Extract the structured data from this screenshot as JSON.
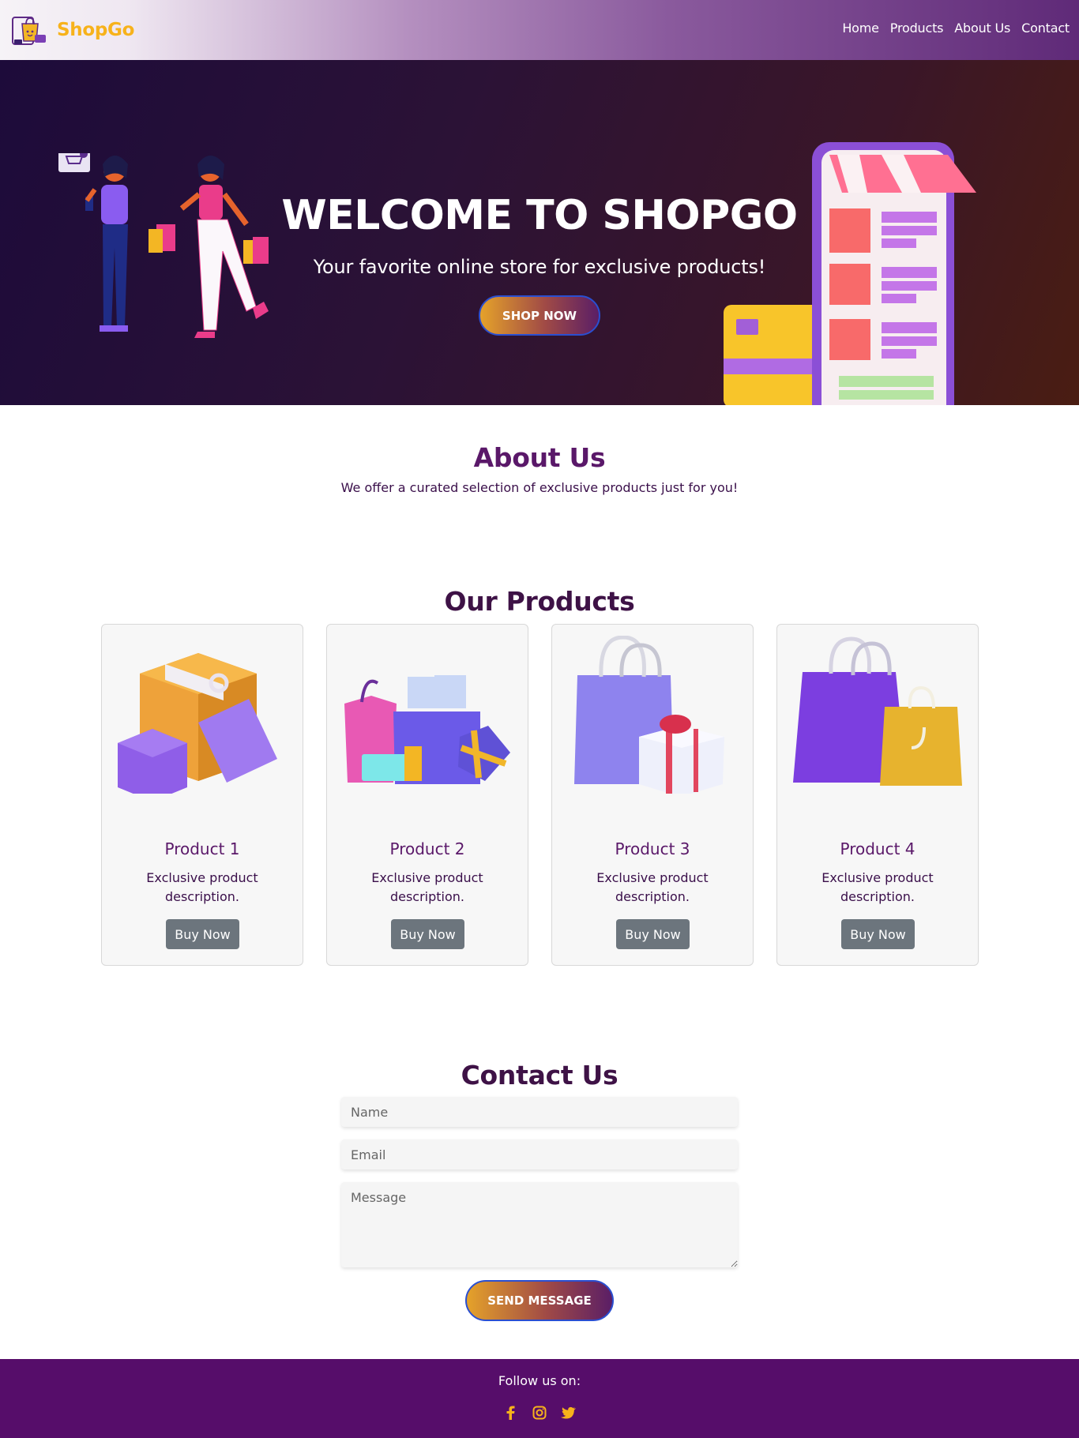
{
  "brand": {
    "name": "ShopGo"
  },
  "nav": {
    "items": [
      {
        "label": "Home"
      },
      {
        "label": "Products"
      },
      {
        "label": "About Us"
      },
      {
        "label": "Contact"
      }
    ]
  },
  "hero": {
    "title": "WELCOME TO SHOPGO",
    "subtitle": "Your favorite online store for exclusive products!",
    "cta": "SHOP NOW"
  },
  "about": {
    "title": "About Us",
    "text": "We offer a curated selection of exclusive products just for you!"
  },
  "products": {
    "title": "Our Products",
    "items": [
      {
        "name": "Product 1",
        "description": "Exclusive product description.",
        "button": "Buy Now",
        "image": "boxes-with-tag-icon"
      },
      {
        "name": "Product 2",
        "description": "Exclusive product description.",
        "button": "Buy Now",
        "image": "bags-cards-gifts-icon"
      },
      {
        "name": "Product 3",
        "description": "Exclusive product description.",
        "button": "Buy Now",
        "image": "bag-and-gift-icon"
      },
      {
        "name": "Product 4",
        "description": "Exclusive product description.",
        "button": "Buy Now",
        "image": "shopping-bags-icon"
      }
    ]
  },
  "contact": {
    "title": "Contact Us",
    "name_placeholder": "Name",
    "email_placeholder": "Email",
    "message_placeholder": "Message",
    "submit": "SEND MESSAGE"
  },
  "footer": {
    "follow": "Follow us on:",
    "social": [
      "facebook-icon",
      "instagram-icon",
      "twitter-icon"
    ]
  },
  "colors": {
    "brand_accent": "#f7b21b",
    "primary_purple": "#5a1869",
    "footer_bg": "#560d6a",
    "button_gray": "#6c757d"
  }
}
